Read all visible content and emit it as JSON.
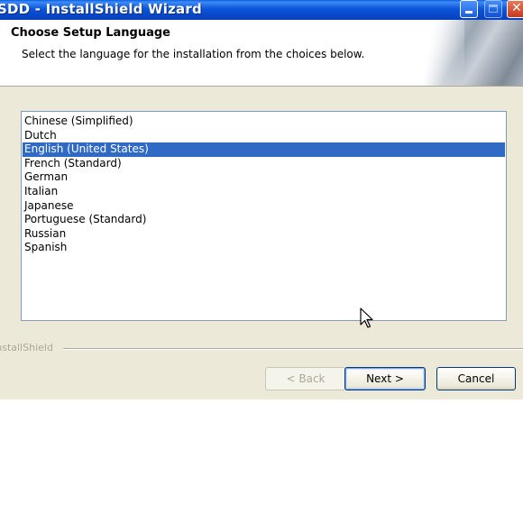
{
  "window": {
    "title": "SDD - InstallShield Wizard"
  },
  "header": {
    "title": "Choose Setup Language",
    "subtitle": "Select the language for the installation from the choices below."
  },
  "languages": {
    "selected_index": 2,
    "items": [
      "Chinese (Simplified)",
      "Dutch",
      "English (United States)",
      "French (Standard)",
      "German",
      "Italian",
      "Japanese",
      "Portuguese (Standard)",
      "Russian",
      "Spanish"
    ]
  },
  "footer": {
    "brand": "InstallShield"
  },
  "buttons": {
    "back": "< Back",
    "next": "Next >",
    "cancel": "Cancel"
  },
  "colors": {
    "selection": "#316ac5",
    "dialog_bg": "#ece9d8",
    "titlebar": "#0b55d8"
  }
}
